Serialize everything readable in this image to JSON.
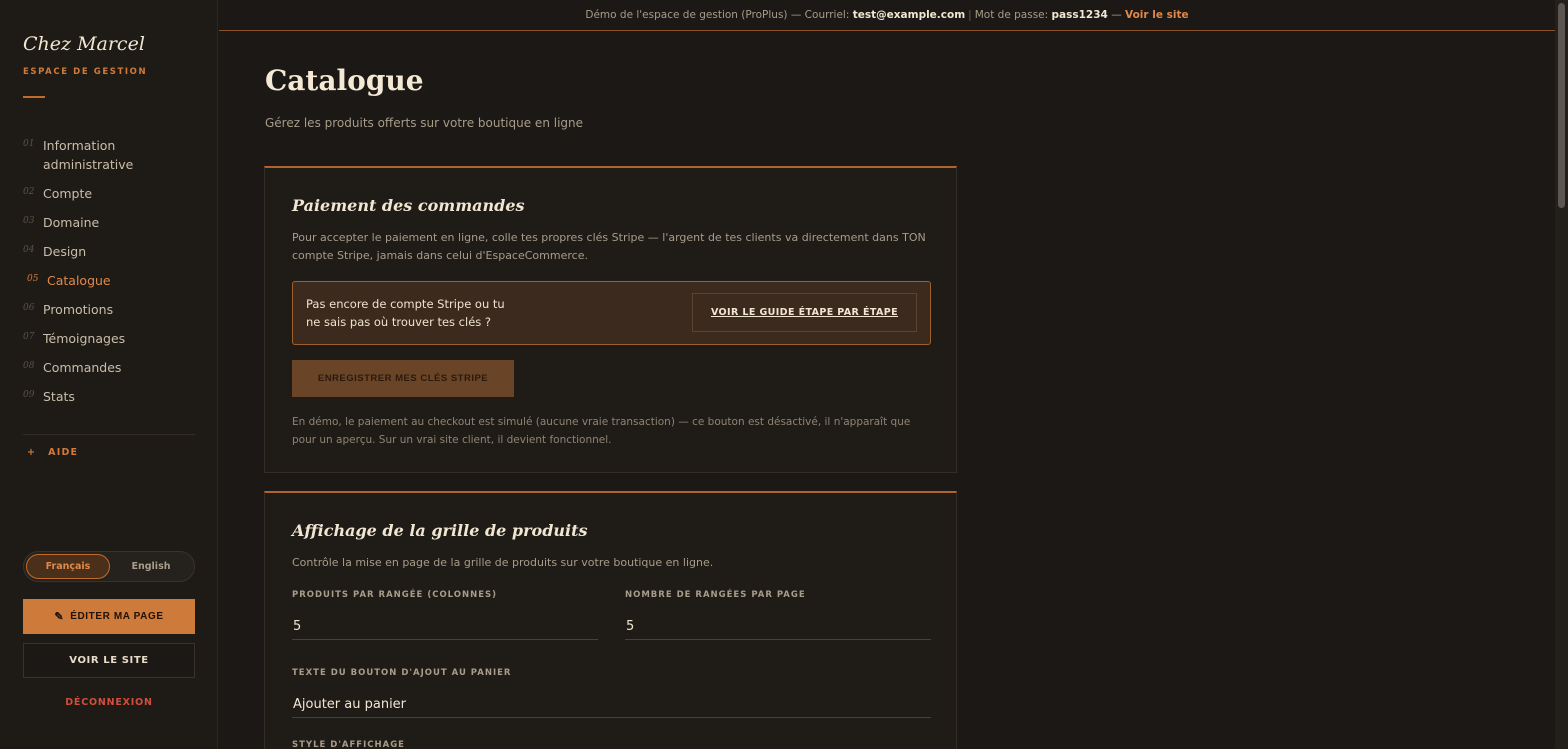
{
  "sidebar": {
    "brand": "Chez Marcel",
    "subtitle": "ESPACE DE GESTION",
    "nav": [
      {
        "num": "01",
        "label": "Information administrative"
      },
      {
        "num": "02",
        "label": "Compte"
      },
      {
        "num": "03",
        "label": "Domaine"
      },
      {
        "num": "04",
        "label": "Design"
      },
      {
        "num": "05",
        "label": "Catalogue",
        "active": true
      },
      {
        "num": "06",
        "label": "Promotions"
      },
      {
        "num": "07",
        "label": "Témoignages"
      },
      {
        "num": "08",
        "label": "Commandes"
      },
      {
        "num": "09",
        "label": "Stats"
      }
    ],
    "help_plus": "+",
    "help_label": "AIDE",
    "lang_fr": "Français",
    "lang_en": "English",
    "edit_icon": "✎",
    "edit_label": "ÉDITER MA PAGE",
    "site_label": "VOIR LE SITE",
    "logout_label": "DÉCONNEXION"
  },
  "banner": {
    "prefix": "Démo de l'espace de gestion (ProPlus) — Courriel:",
    "email": "test@example.com",
    "sep": "|",
    "pw_label": "Mot de passe:",
    "password": "pass1234",
    "dash": "—",
    "link": "Voir le site"
  },
  "main": {
    "title": "Catalogue",
    "subtitle": "Gérez les produits offerts sur votre boutique en ligne"
  },
  "payment": {
    "title": "Paiement des commandes",
    "desc": "Pour accepter le paiement en ligne, colle tes propres clés Stripe — l'argent de tes clients va directement dans TON compte Stripe, jamais dans celui d'EspaceCommerce.",
    "stripe_prompt": "Pas encore de compte Stripe ou tu ne sais pas où trouver tes clés ?",
    "guide_label": "VOIR LE GUIDE ÉTAPE PAR ÉTAPE",
    "save_label": "ENREGISTRER MES CLÉS STRIPE",
    "demo_note": "En démo, le paiement au checkout est simulé (aucune vraie transaction) — ce bouton est désactivé, il n'apparaît que pour un aperçu. Sur un vrai site client, il devient fonctionnel."
  },
  "grid": {
    "title": "Affichage de la grille de produits",
    "desc": "Contrôle la mise en page de la grille de produits sur votre boutique en ligne.",
    "cols_label": "PRODUITS PAR RANGÉE (COLONNES)",
    "cols_value": "5",
    "rows_label": "NOMBRE DE RANGÉES PAR PAGE",
    "rows_value": "5",
    "cart_label": "TEXTE DU BOUTON D'AJOUT AU PANIER",
    "cart_value": "Ajouter au panier",
    "style_label": "STYLE D'AFFICHAGE"
  },
  "colors": {
    "accent": "#cd7a3b",
    "background": "#1b1815",
    "danger": "#d14e3c"
  }
}
